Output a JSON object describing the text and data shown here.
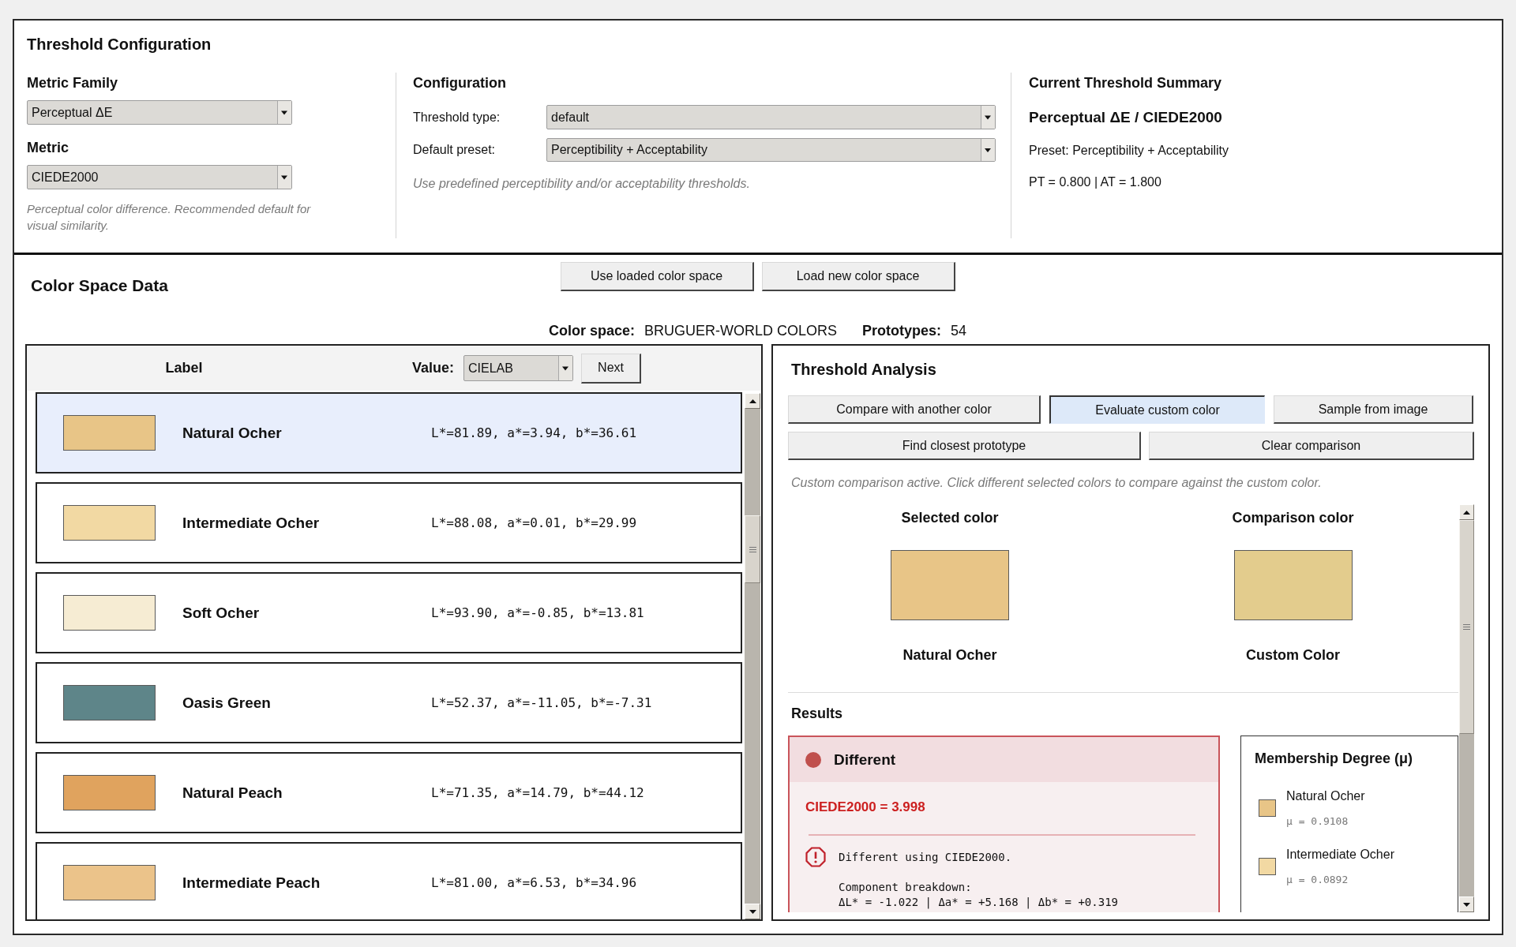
{
  "threshold_configuration": {
    "title": "Threshold Configuration",
    "metric_family": {
      "label": "Metric Family",
      "value": "Perceptual ΔE"
    },
    "metric": {
      "label": "Metric",
      "value": "CIEDE2000"
    },
    "metric_note": "Perceptual color difference. Recommended default for visual similarity.",
    "configuration": {
      "title": "Configuration",
      "fields": [
        {
          "label": "Threshold type:",
          "value": "default"
        },
        {
          "label": "Default preset:",
          "value": "Perceptibility + Acceptability"
        }
      ],
      "note": "Use predefined perceptibility and/or acceptability thresholds."
    },
    "summary": {
      "title": "Current Threshold Summary",
      "heading": "Perceptual ΔE / CIEDE2000",
      "preset": "Preset: Perceptibility + Acceptability",
      "thresholds": "PT = 0.800 | AT = 1.800"
    }
  },
  "color_space_data": {
    "title": "Color Space Data",
    "buttons": [
      "Use loaded color space",
      "Load new color space"
    ],
    "color_space": {
      "label": "Color space:",
      "value": "BRUGUER-WORLD COLORS"
    },
    "prototypes": {
      "label": "Prototypes:",
      "value": "54"
    },
    "table": {
      "label_header": "Label",
      "value_header": "Value:",
      "value_format": "CIELAB",
      "next_button": "Next",
      "rows": [
        {
          "name": "Natural Ocher",
          "value": "L*=81.89, a*=3.94, b*=36.61",
          "color": "#e8c587",
          "selected": true
        },
        {
          "name": "Intermediate Ocher",
          "value": "L*=88.08, a*=0.01, b*=29.99",
          "color": "#f2d9a3",
          "selected": false
        },
        {
          "name": "Soft Ocher",
          "value": "L*=93.90, a*=-0.85, b*=13.81",
          "color": "#f6ecd3",
          "selected": false
        },
        {
          "name": "Oasis Green",
          "value": "L*=52.37, a*=-11.05, b*=-7.31",
          "color": "#5e8589",
          "selected": false
        },
        {
          "name": "Natural Peach",
          "value": "L*=71.35, a*=14.79, b*=44.12",
          "color": "#e0a35e",
          "selected": false
        },
        {
          "name": "Intermediate Peach",
          "value": "L*=81.00, a*=6.53, b*=34.96",
          "color": "#ebc38a",
          "selected": false
        }
      ]
    }
  },
  "threshold_analysis": {
    "title": "Threshold Analysis",
    "mode_buttons": [
      {
        "label": "Compare with another color",
        "selected": false
      },
      {
        "label": "Evaluate custom color",
        "selected": true
      },
      {
        "label": "Sample from image",
        "selected": false
      }
    ],
    "action_buttons": [
      "Find closest prototype",
      "Clear comparison"
    ],
    "note": "Custom comparison active. Click different selected colors to compare against the custom color.",
    "compare_colors": [
      {
        "heading": "Selected color",
        "name": "Natural Ocher",
        "color": "#e8c587"
      },
      {
        "heading": "Comparison color",
        "name": "Custom Color",
        "color": "#e3cc8d"
      }
    ],
    "results": {
      "title": "Results",
      "verdict": {
        "kind": "different",
        "label": "Different"
      },
      "score": "CIEDE2000 = 3.998",
      "message": "Different using CIEDE2000.",
      "breakdown_title": "Component breakdown:",
      "breakdown": "ΔL* = -1.022 | Δa* = +5.168 | Δb* = +0.319"
    },
    "membership": {
      "title": "Membership Degree (μ)",
      "items": [
        {
          "name": "Natural Ocher",
          "value": "μ = 0.9108",
          "color": "#e8c587"
        },
        {
          "name": "Intermediate Ocher",
          "value": "μ = 0.0892",
          "color": "#f2d9a3"
        }
      ]
    }
  }
}
